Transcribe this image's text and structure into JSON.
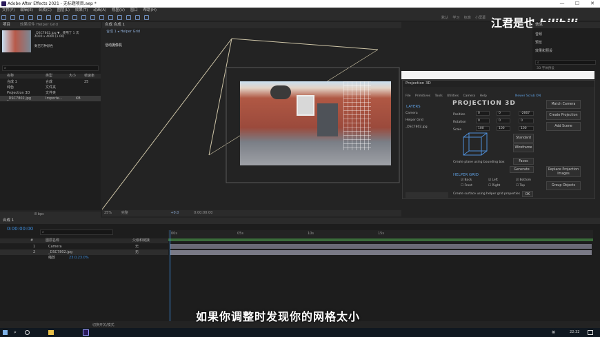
{
  "window": {
    "title": "Adobe After Effects 2021 - 无标题项目.aep *"
  },
  "menu": [
    "文件(F)",
    "编辑(E)",
    "合成(C)",
    "图层(L)",
    "效果(T)",
    "动画(A)",
    "视图(V)",
    "窗口",
    "帮助(H)"
  ],
  "toolbar": {
    "right_labels": [
      "默认",
      "学习",
      "标准",
      "小屏幕"
    ]
  },
  "watermark": {
    "text": "江君是也",
    "logo": "bilibili"
  },
  "project": {
    "tab": "项目",
    "effects_tab": "效果控件 Helper Grid",
    "file_name": "_DSC7802.jpg ▼ , 使用了 1 次",
    "file_dims": "4000 x 4000 (1.00)",
    "file_color": "数百万种颜色",
    "columns": [
      "名称",
      "类型",
      "大小",
      "帧速率"
    ],
    "rows": [
      {
        "name": "合成 1",
        "type": "合成",
        "size": "",
        "fps": "25"
      },
      {
        "name": "纯色",
        "type": "文件夹",
        "size": "",
        "fps": ""
      },
      {
        "name": "Projection 3D",
        "type": "文件夹",
        "size": "",
        "fps": ""
      },
      {
        "name": "_DSC7802.jpg",
        "type": "Importe...",
        "size": "KB",
        "fps": ""
      }
    ],
    "bpc": "8 bpc"
  },
  "comp": {
    "tab": "合成 合成 1",
    "breadcrumb": "合成 1 ◂ Helper Grid",
    "camera_label": "活动摄像机",
    "zoom": "25%",
    "quality": "完整",
    "exposure": "+0.0",
    "time": "0:00:00:00"
  },
  "right_panel": {
    "title": "信息",
    "items": [
      "音频",
      "预览",
      "效果和预设"
    ],
    "effect_search": "",
    "item_3d": "3D 字体预设"
  },
  "projection3d": {
    "tab": "Projection 3D",
    "menu": [
      "File",
      "Primitives",
      "Tools",
      "Utilities",
      "Camera",
      "Help"
    ],
    "version": "Newer Scrub ON",
    "logo": "PROJECTION 3D",
    "layers_title": "LAYERS",
    "layers": [
      "Camera",
      "Helper Grid",
      "_DSC7802.jpg"
    ],
    "position": {
      "x": "0",
      "y": "0",
      "z": "-2667"
    },
    "rotation": {
      "x": "0",
      "y": "0",
      "z": "0"
    },
    "scale": {
      "x": "100",
      "y": "100",
      "z": "100"
    },
    "labels": {
      "position": "Position",
      "rotation": "Rotation",
      "scale": "Scale"
    },
    "buttons": [
      "Match Camera",
      "Create Projection",
      "Add Scene",
      "Standard",
      "Wireframe",
      "Replace Projection Images",
      "Group Objects"
    ],
    "faces": "Faces",
    "generate": "Generate",
    "bbox_text": "Create plane using bounding box",
    "helper_title": "HELPER GRID",
    "checks": [
      "Back",
      "Left",
      "Bottom",
      "Front",
      "Right",
      "Top"
    ],
    "helper_text": "Create surface using helper grid properties",
    "ok": "OK"
  },
  "timeline": {
    "tab": "合成 1",
    "time": "0:00:00:00",
    "columns": [
      "#",
      "图层名称",
      "父级和链接"
    ],
    "layers": [
      {
        "num": "1",
        "name": "Camera",
        "parent": "无"
      },
      {
        "num": "2",
        "name": "_DSC7802.jpg",
        "parent": "无"
      }
    ],
    "transform": "缩放",
    "scale_val": "23.0,23.0%",
    "ruler": [
      "00s",
      "05s",
      "10s",
      "15s"
    ],
    "footer": "切换开关/模式"
  },
  "subtitle": "如果你调整时发现你的网格太小",
  "taskbar": {
    "time": "22:32",
    "lang": "英"
  }
}
